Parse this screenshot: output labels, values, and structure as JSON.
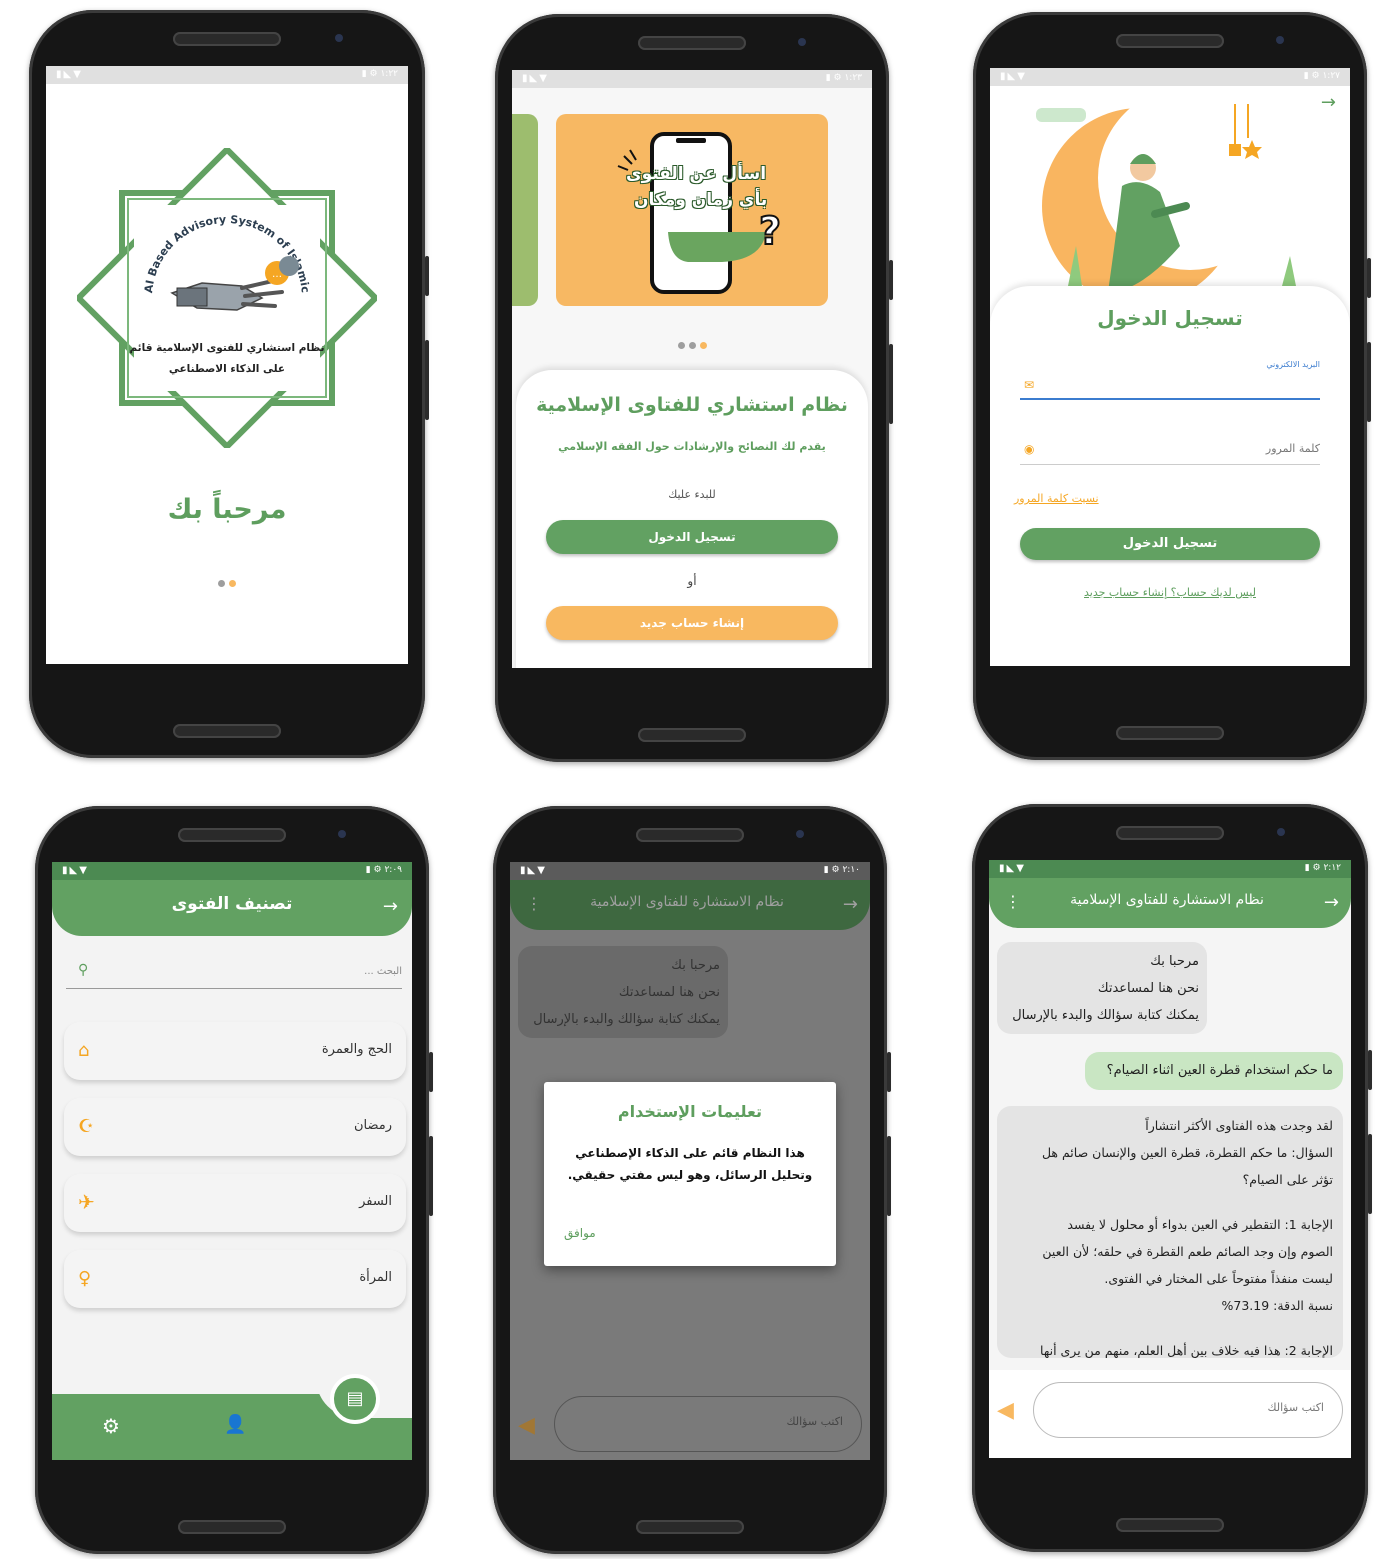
{
  "status_bar": {
    "left_icons": "▮◣▼",
    "right_icons": "▮ ⚙"
  },
  "screens": {
    "splash": {
      "time": "١:٢٢",
      "logo_arc_text": "AI Based Advisory System of Islamic Fatwa",
      "logo_arabic_line1": "نظام استشاري للفتوى الإسلامية قائم",
      "logo_arabic_line2": "على الذكاء الاصطناعي",
      "welcome": "مرحباً بك"
    },
    "onboarding": {
      "time": "١:٢٣",
      "banner_line1": "اسأل عن الفتوى",
      "banner_line2": "بأي زمان ومكان",
      "title": "نظام استشاري للفتاوى الإسلامية",
      "subtitle": "يقدم لك النصائح والإرشادات حول الفقه الإسلامي",
      "start_label": "للبدء عليك",
      "login_button": "تسجيل الدخول",
      "or": "أو",
      "register_button": "إنشاء حساب جديد"
    },
    "login": {
      "time": "١:٢٧",
      "title": "تسجيل الدخول",
      "email_label": "البريد الالكتروني",
      "password_placeholder": "كلمة المرور",
      "forgot": "نسيت كلمة المرور",
      "login_button": "تسجيل الدخول",
      "no_account": "ليس لديك حساب؟ إنشاء حساب جديد"
    },
    "categories": {
      "time": "٢:٠٩",
      "header_title": "تصنيف الفتوى",
      "search_placeholder": "البحث ...",
      "items": [
        {
          "label": "الحج والعمرة",
          "icon": "kaaba-icon"
        },
        {
          "label": "رمضان",
          "icon": "crescent-icon"
        },
        {
          "label": "السفر",
          "icon": "airplane-icon"
        },
        {
          "label": "المرأة",
          "icon": "woman-icon"
        }
      ]
    },
    "dialog": {
      "time": "٢:١٠",
      "header_title": "نظام الاستشارة للفتاوى الإسلامية",
      "bubble_lines": [
        "مرحبا بك",
        "نحن هنا لمساعدتك",
        "يمكنك كتابة سؤالك والبدء بالإرسال"
      ],
      "dialog_title": "تعليمات الإستخدام",
      "dialog_line1": "هذا النظام قائم على الذكاء الإصطناعي",
      "dialog_line2": "وتحليل الرسائل، وهو ليس مفتي حقيقي.",
      "dialog_ok": "موافق",
      "input_placeholder": "اكتب سؤالك"
    },
    "chat": {
      "time": "٢:١٢",
      "header_title": "نظام الاستشارة للفتاوى الإسلامية",
      "bubble_lines": [
        "مرحبا بك",
        "نحن هنا لمساعدتك",
        "يمكنك كتابة سؤالك والبدء بالإرسال"
      ],
      "user_question": "ما حكم استخدام قطرة العين اثناء الصيام؟",
      "answer_lines": [
        "لقد وجدت هذه الفتاوى الأكثر انتشاراً",
        "السؤال: ما حكم القطرة، قطرة العين والإنسان صائم هل",
        "تؤثر على الصيام؟",
        "",
        "الإجابة 1: التقطير في العين بدواء أو محلول لا يفسد",
        "الصوم وإن وجد الصائم طعم القطرة في حلقه؛ لأن العين",
        "ليست منفذاً مفتوحاً على المختار في الفتوى.",
        "نسبة الدقة: 73.19%",
        "",
        "الإجابة 2: هذا فيه خلاف بين أهل العلم، منهم من يرى أنها"
      ],
      "input_placeholder": "اكتب سؤالك"
    }
  },
  "colors": {
    "green": "#62a162",
    "orange": "#f8b860",
    "dark_green": "#4c8a52"
  }
}
